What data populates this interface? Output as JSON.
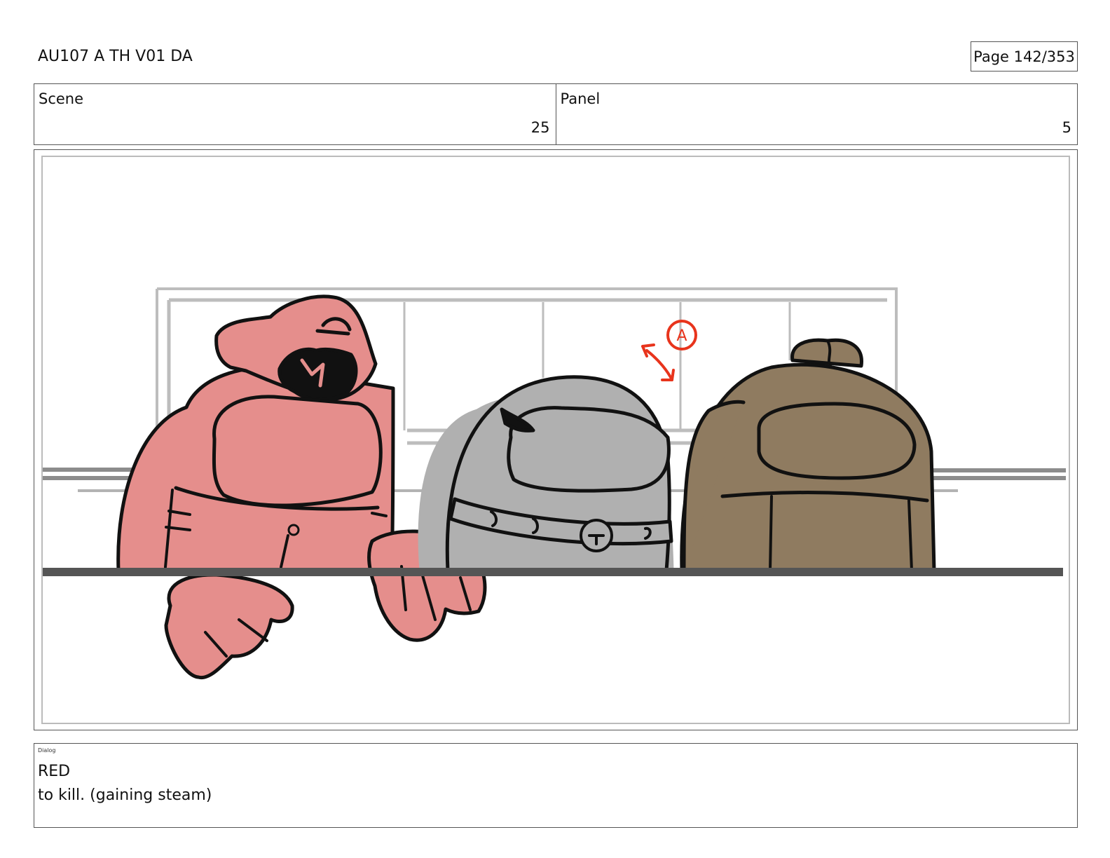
{
  "header": {
    "title": "AU107 A TH V01 DA",
    "page_label": "Page 142/353"
  },
  "info": {
    "scene_label": "Scene",
    "scene_value": "25",
    "panel_label": "Panel",
    "panel_value": "5"
  },
  "drawing": {
    "annotation_letter": "A",
    "colors": {
      "red_crewmate": "#e58e8c",
      "gray_crewmate": "#b0b0b0",
      "brown_crewmate": "#8f7b60",
      "annotation": "#e8341c",
      "table": "#555555"
    }
  },
  "dialog": {
    "label": "Dialog",
    "speaker": "RED",
    "line": "to kill. (gaining steam)"
  }
}
